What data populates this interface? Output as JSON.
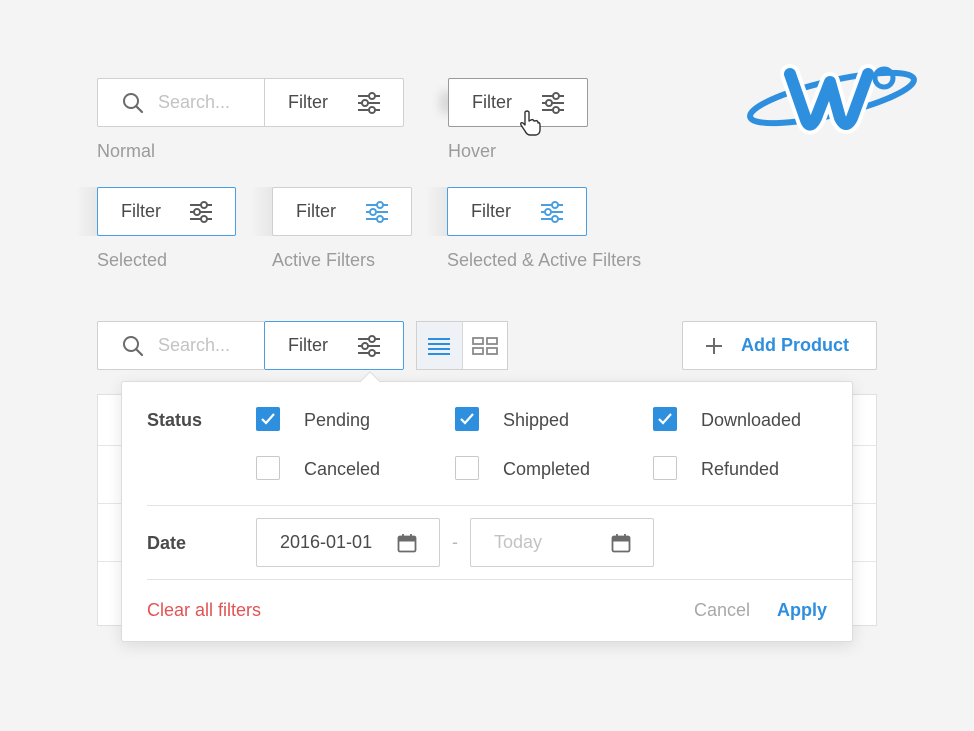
{
  "search": {
    "placeholder": "Search..."
  },
  "filter_label": "Filter",
  "states": {
    "normal": "Normal",
    "hover": "Hover",
    "selected": "Selected",
    "active": "Active Filters",
    "selected_active": "Selected & Active Filters"
  },
  "toolbar": {
    "add_product_label": "Add Product"
  },
  "panel": {
    "status_label": "Status",
    "status_options": [
      {
        "label": "Pending",
        "checked": true
      },
      {
        "label": "Shipped",
        "checked": true
      },
      {
        "label": "Downloaded",
        "checked": true
      },
      {
        "label": "Canceled",
        "checked": false
      },
      {
        "label": "Completed",
        "checked": false
      },
      {
        "label": "Refunded",
        "checked": false
      }
    ],
    "date_label": "Date",
    "date_from": "2016-01-01",
    "date_to_placeholder": "Today",
    "date_separator": "-",
    "clear_label": "Clear all filters",
    "cancel_label": "Cancel",
    "apply_label": "Apply"
  },
  "colors": {
    "accent": "#2f8fdf",
    "danger": "#e25454",
    "border": "#d0d0d0",
    "text": "#4a4a4a",
    "muted": "#9b9b9b"
  }
}
